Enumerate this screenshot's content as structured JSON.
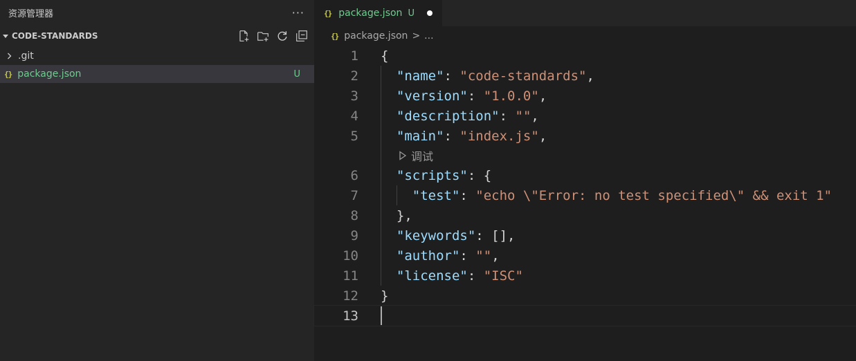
{
  "sidebar": {
    "title": "资源管理器",
    "more": "···",
    "section": "CODE-STANDARDS",
    "actions": [
      "new-file-icon",
      "new-folder-icon",
      "refresh-icon",
      "collapse-all-icon"
    ],
    "tree": [
      {
        "label": ".git",
        "type": "folder"
      },
      {
        "label": "package.json",
        "type": "file",
        "badge": "U",
        "icon": "{}"
      }
    ]
  },
  "tab": {
    "icon": "{}",
    "label": "package.json",
    "badge": "U"
  },
  "breadcrumbs": {
    "icon": "{}",
    "file": "package.json",
    "sep": ">",
    "more": "..."
  },
  "codelens": {
    "label": "调试"
  },
  "code": [
    {
      "n": "1",
      "t": "{"
    },
    {
      "n": "2",
      "key": "\"name\"",
      "val": "\"code-standards\"",
      "end": ",",
      "indent": "  "
    },
    {
      "n": "3",
      "key": "\"version\"",
      "val": "\"1.0.0\"",
      "end": ",",
      "indent": "  "
    },
    {
      "n": "4",
      "key": "\"description\"",
      "val": "\"\"",
      "end": ",",
      "indent": "  "
    },
    {
      "n": "5",
      "key": "\"main\"",
      "val": "\"index.js\"",
      "end": ",",
      "indent": "  "
    },
    {
      "n": "6",
      "key": "\"scripts\"",
      "raw": "{",
      "indent": "  "
    },
    {
      "n": "7",
      "key": "\"test\"",
      "val": "\"echo \\\"Error: no test specified\\\" && exit 1\"",
      "end": "",
      "indent": "    "
    },
    {
      "n": "8",
      "t": "  },"
    },
    {
      "n": "9",
      "key": "\"keywords\"",
      "raw": "[],",
      "indent": "  "
    },
    {
      "n": "10",
      "key": "\"author\"",
      "val": "\"\"",
      "end": ",",
      "indent": "  "
    },
    {
      "n": "11",
      "key": "\"license\"",
      "val": "\"ISC\"",
      "end": "",
      "indent": "  "
    },
    {
      "n": "12",
      "t": "}"
    },
    {
      "n": "13",
      "t": ""
    }
  ],
  "colors": {
    "key": "#9cdcfe",
    "string": "#ce9178",
    "untracked": "#73c991",
    "json_icon": "#cbcb41"
  }
}
